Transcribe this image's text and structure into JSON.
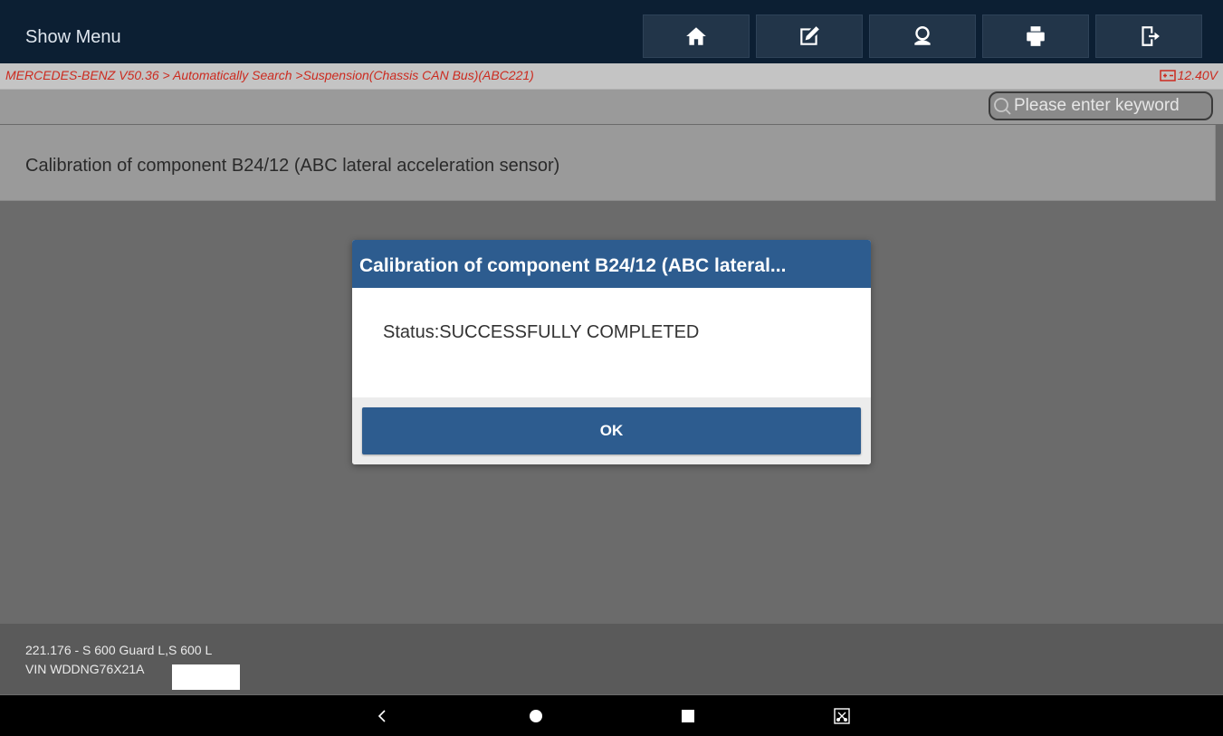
{
  "topbar": {
    "title": "Show Menu",
    "buttons": [
      {
        "icon": "home-icon"
      },
      {
        "icon": "edit-report-icon"
      },
      {
        "icon": "remote-support-icon"
      },
      {
        "icon": "print-icon"
      },
      {
        "icon": "exit-icon"
      }
    ]
  },
  "breadcrumb": {
    "path": "MERCEDES-BENZ V50.36 > Automatically Search >Suspension(Chassis CAN Bus)(ABC221)",
    "voltage": "12.40V",
    "color": "#cc2a1f"
  },
  "search": {
    "placeholder": "Please enter keyword"
  },
  "list": {
    "items": [
      "Calibration of component B24/12 (ABC lateral acceleration sensor)"
    ]
  },
  "dialog": {
    "title": "Calibration of component B24/12 (ABC lateral...",
    "message": "Status:SUCCESSFULLY COMPLETED",
    "ok_label": "OK",
    "accent": "#2d5c8f"
  },
  "vehicle": {
    "model": "221.176 - S 600 Guard L,S 600 L",
    "vin": "VIN WDDNG76X21A"
  },
  "navbar": {
    "icons": [
      "back-icon",
      "home-circle-icon",
      "recents-icon",
      "screenshot-icon"
    ]
  }
}
